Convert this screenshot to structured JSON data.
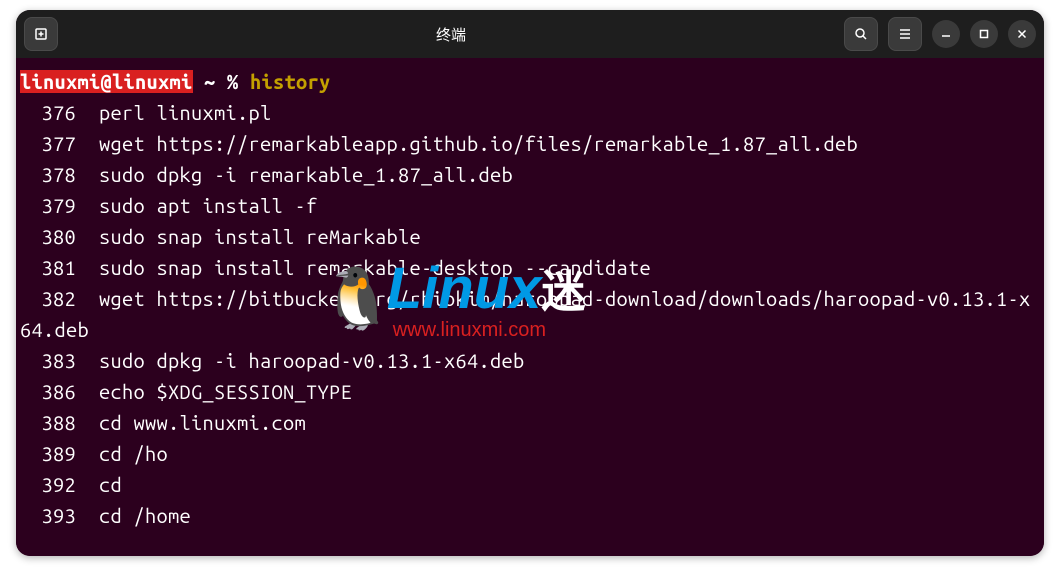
{
  "window": {
    "title": "终端"
  },
  "prompt": {
    "user_host": "linuxmi@linuxmi",
    "path": "~",
    "symbol": "%",
    "command": "history"
  },
  "history": [
    {
      "num": "376",
      "cmd": "perl linuxmi.pl"
    },
    {
      "num": "377",
      "cmd": "wget https://remarkableapp.github.io/files/remarkable_1.87_all.deb"
    },
    {
      "num": "378",
      "cmd": "sudo dpkg -i remarkable_1.87_all.deb"
    },
    {
      "num": "379",
      "cmd": "sudo apt install -f"
    },
    {
      "num": "380",
      "cmd": "sudo snap install reMarkable"
    },
    {
      "num": "381",
      "cmd": "sudo snap install remarkable-desktop --candidate"
    },
    {
      "num": "382",
      "cmd": "wget https://bitbucket.org/rhiokim/haroopad-download/downloads/haroopad-v0.13.1-x64.deb"
    },
    {
      "num": "383",
      "cmd": "sudo dpkg -i haroopad-v0.13.1-x64.deb"
    },
    {
      "num": "386",
      "cmd": "echo $XDG_SESSION_TYPE"
    },
    {
      "num": "388",
      "cmd": "cd www.linuxmi.com"
    },
    {
      "num": "389",
      "cmd": "cd /ho"
    },
    {
      "num": "392",
      "cmd": "cd"
    },
    {
      "num": "393",
      "cmd": "cd /home"
    }
  ],
  "watermark": {
    "brand": "Linux",
    "cn": "迷",
    "url": "www.linuxmi.com"
  }
}
